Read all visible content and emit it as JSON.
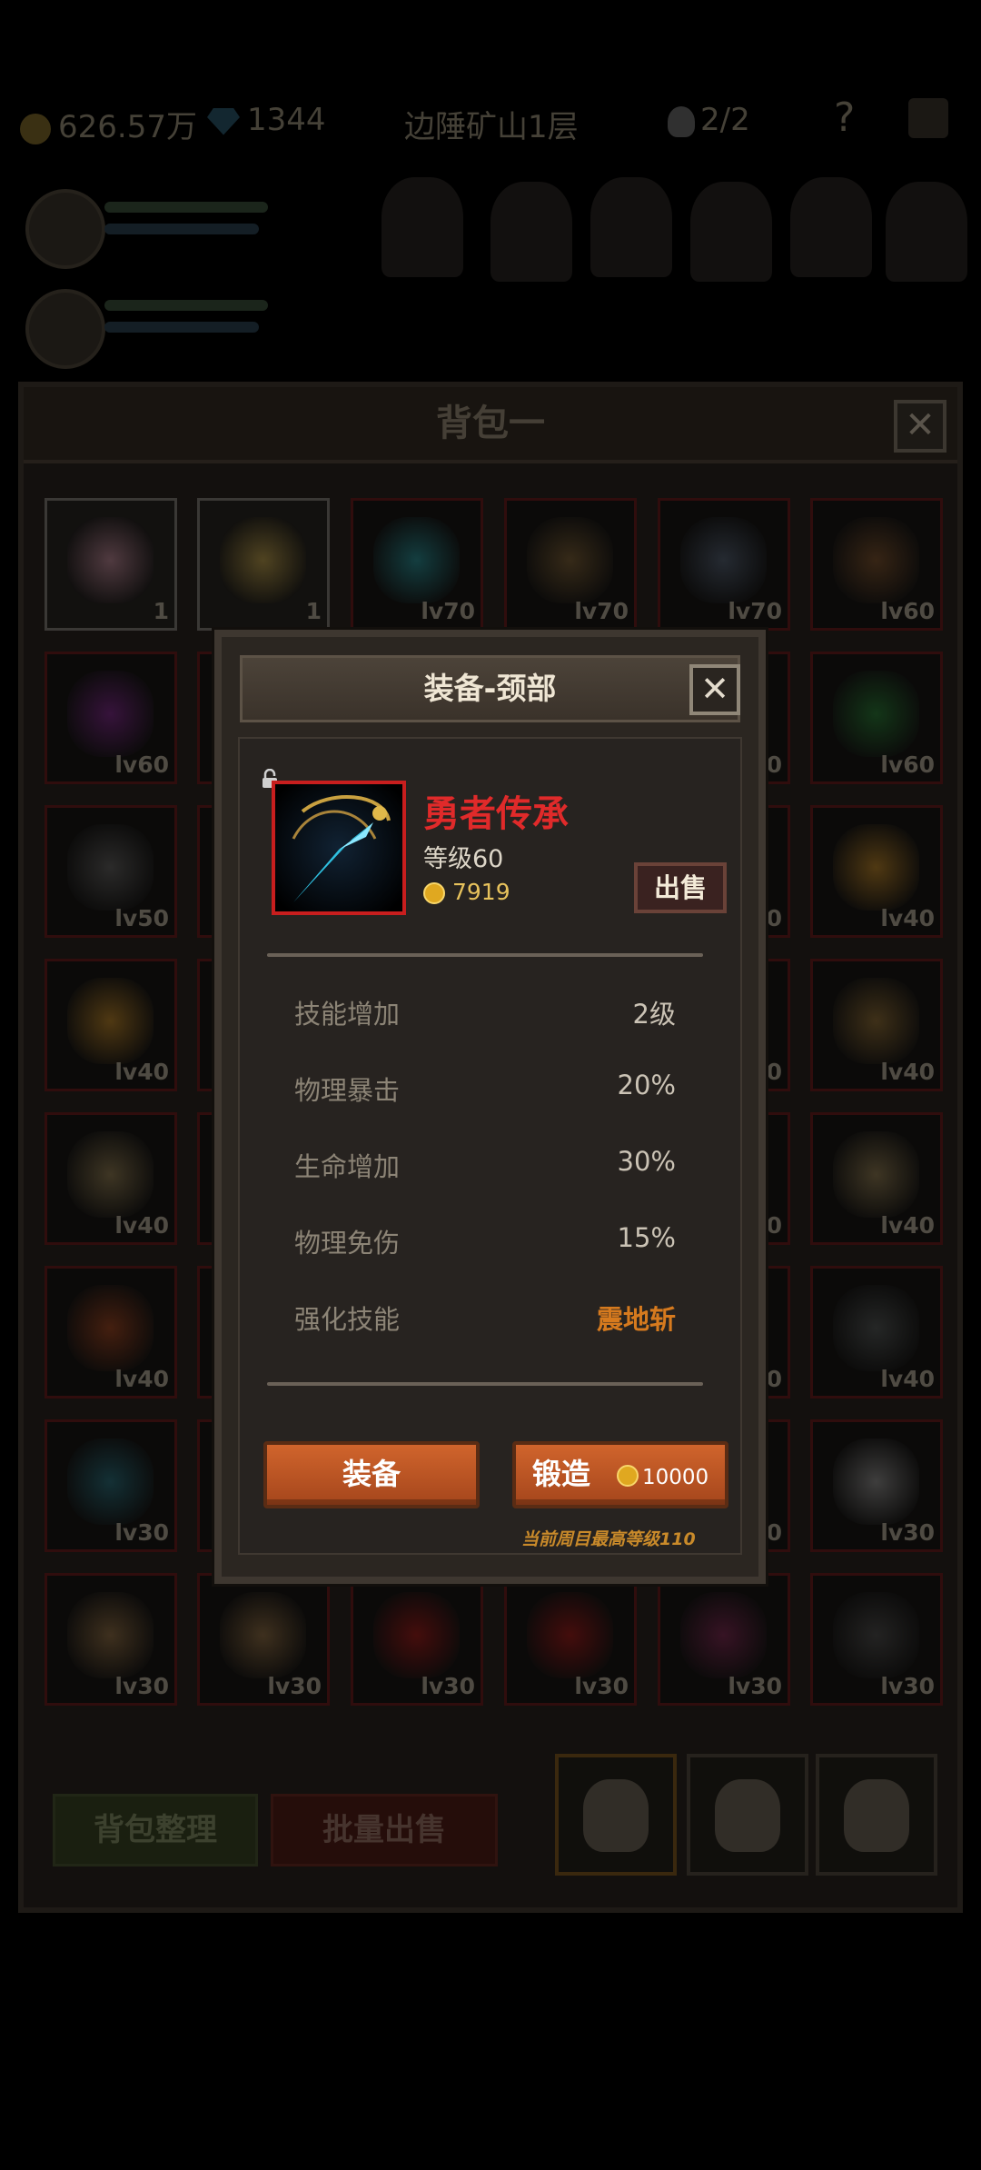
{
  "hud": {
    "gold": "626.57万",
    "gems": "1344",
    "location": "边陲矿山1层",
    "heroes": "2/2",
    "help": "?"
  },
  "bag": {
    "title": "背包一",
    "close": "✕",
    "slots": [
      {
        "label": "1",
        "type": "consumable",
        "color": "#c98da0"
      },
      {
        "label": "1",
        "type": "consumable",
        "color": "#c9a84a"
      },
      {
        "label": "lv70",
        "color": "#2aa0a8"
      },
      {
        "label": "lv70",
        "color": "#8a6a3a"
      },
      {
        "label": "lv70",
        "color": "#5a6a80"
      },
      {
        "label": "lv60",
        "color": "#8a5a30"
      },
      {
        "label": "lv60",
        "color": "#8a2a9a"
      },
      {
        "label": "",
        "color": "#222"
      },
      {
        "label": "",
        "color": "#222"
      },
      {
        "label": "",
        "color": "#222"
      },
      {
        "label": "0",
        "color": "#222"
      },
      {
        "label": "lv60",
        "color": "#2a8a3a"
      },
      {
        "label": "lv50",
        "color": "#6a6a6a"
      },
      {
        "label": "",
        "color": "#222"
      },
      {
        "label": "",
        "color": "#222"
      },
      {
        "label": "",
        "color": "#222"
      },
      {
        "label": "0",
        "color": "#222"
      },
      {
        "label": "lv40",
        "color": "#d0922a"
      },
      {
        "label": "lv40",
        "color": "#d0922a"
      },
      {
        "label": "",
        "color": "#222"
      },
      {
        "label": "",
        "color": "#222"
      },
      {
        "label": "",
        "color": "#222"
      },
      {
        "label": "0",
        "color": "#222"
      },
      {
        "label": "lv40",
        "color": "#a07a3a"
      },
      {
        "label": "lv40",
        "color": "#a08a5a"
      },
      {
        "label": "",
        "color": "#222"
      },
      {
        "label": "",
        "color": "#222"
      },
      {
        "label": "",
        "color": "#222"
      },
      {
        "label": "0",
        "color": "#222"
      },
      {
        "label": "lv40",
        "color": "#a08a5a"
      },
      {
        "label": "lv40",
        "color": "#b04a20"
      },
      {
        "label": "",
        "color": "#222"
      },
      {
        "label": "",
        "color": "#222"
      },
      {
        "label": "",
        "color": "#222"
      },
      {
        "label": "0",
        "color": "#222"
      },
      {
        "label": "lv40",
        "color": "#5a6060"
      },
      {
        "label": "lv30",
        "color": "#2a7a8a"
      },
      {
        "label": "",
        "color": "#222"
      },
      {
        "label": "",
        "color": "#222"
      },
      {
        "label": "",
        "color": "#222"
      },
      {
        "label": "0",
        "color": "#222"
      },
      {
        "label": "lv30",
        "color": "#a0a0a0"
      },
      {
        "label": "lv30",
        "color": "#a07a4a"
      },
      {
        "label": "lv30",
        "color": "#a07a4a"
      },
      {
        "label": "lv30",
        "color": "#b01818"
      },
      {
        "label": "lv30",
        "color": "#b01818"
      },
      {
        "label": "lv30",
        "color": "#8a2a5a"
      },
      {
        "label": "lv30",
        "color": "#555555"
      }
    ],
    "sort_button": "背包整理",
    "batch_sell_button": "批量出售"
  },
  "dialog": {
    "title": "装备-颈部",
    "close": "✕",
    "item_name": "勇者传承",
    "item_level": "等级60",
    "item_price": "7919",
    "sell_button": "出售",
    "stats": [
      {
        "key": "技能增加",
        "value": "2级"
      },
      {
        "key": "物理暴击",
        "value": "20%"
      },
      {
        "key": "生命增加",
        "value": "30%"
      },
      {
        "key": "物理免伤",
        "value": "15%"
      },
      {
        "key": "强化技能",
        "value": "震地斩",
        "highlight": true
      }
    ],
    "equip_button": "装备",
    "forge_button": "锻造",
    "forge_cost": "10000",
    "note": "当前周目最高等级110"
  },
  "colors": {
    "item_name": "#e02a2a",
    "highlight": "#d67a1e",
    "rare_border": "#c81e1e",
    "button": "#c65a26"
  }
}
